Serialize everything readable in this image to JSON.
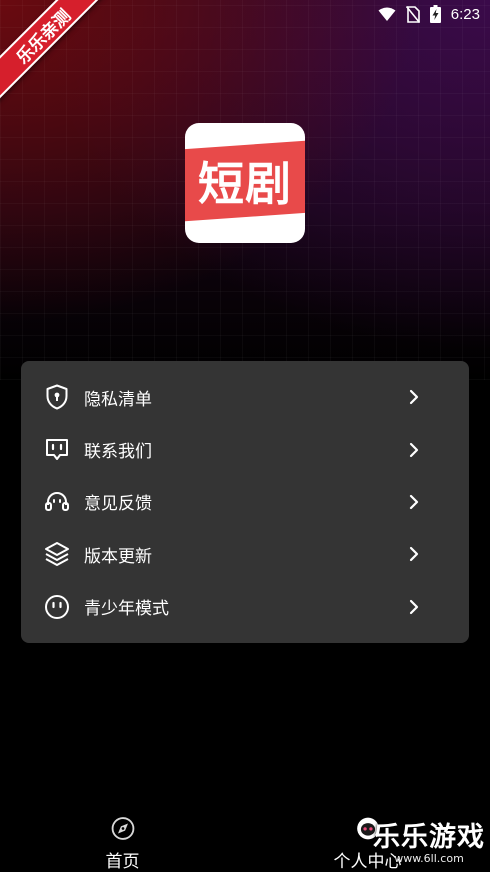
{
  "status_bar": {
    "time": "6:23"
  },
  "ribbon": {
    "text": "乐乐亲测"
  },
  "app_logo": {
    "text": "短剧",
    "accent": "#e84a4a"
  },
  "menu": {
    "items": [
      {
        "label": "隐私清单",
        "icon": "shield-lock-icon"
      },
      {
        "label": "联系我们",
        "icon": "chat-icon"
      },
      {
        "label": "意见反馈",
        "icon": "headset-icon"
      },
      {
        "label": "版本更新",
        "icon": "layers-icon"
      },
      {
        "label": "青少年模式",
        "icon": "smile-face-icon"
      }
    ]
  },
  "bottom_nav": {
    "home": {
      "label": "首页",
      "icon": "compass-icon"
    },
    "profile": {
      "label": "个人中心",
      "icon": "user-face-icon"
    }
  },
  "watermark": {
    "title": "乐乐游戏",
    "url": "www.6ll.com"
  }
}
